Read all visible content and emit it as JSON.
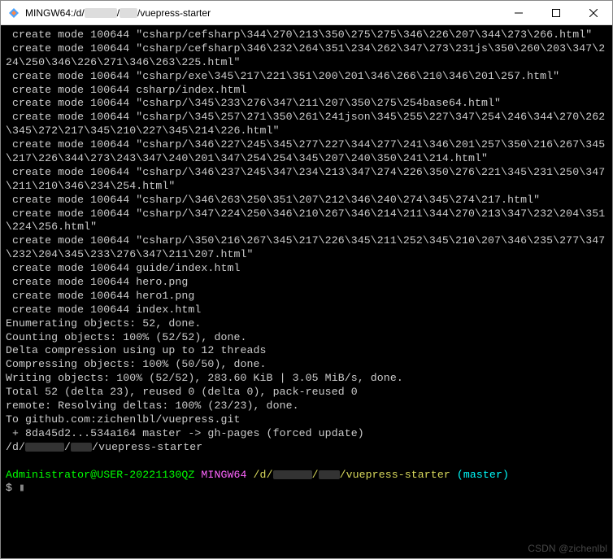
{
  "titlebar": {
    "title_prefix": "MINGW64:/d/",
    "title_suffix": "/vuepress-starter"
  },
  "output_lines": [
    " create mode 100644 \"csharp/cefsharp\\344\\270\\213\\350\\275\\275\\346\\226\\207\\344\\273\\266.html\"",
    " create mode 100644 \"csharp/cefsharp\\346\\232\\264\\351\\234\\262\\347\\273\\231js\\350\\260\\203\\347\\224\\250\\346\\226\\271\\346\\263\\225.html\"",
    " create mode 100644 \"csharp/exe\\345\\217\\221\\351\\200\\201\\346\\266\\210\\346\\201\\257.html\"",
    " create mode 100644 csharp/index.html",
    " create mode 100644 \"csharp/\\345\\233\\276\\347\\211\\207\\350\\275\\254base64.html\"",
    " create mode 100644 \"csharp/\\345\\257\\271\\350\\261\\241json\\345\\255\\227\\347\\254\\246\\344\\270\\262\\345\\272\\217\\345\\210\\227\\345\\214\\226.html\"",
    " create mode 100644 \"csharp/\\346\\227\\245\\345\\277\\227\\344\\277\\241\\346\\201\\257\\350\\216\\267\\345\\217\\226\\344\\273\\243\\347\\240\\201\\347\\254\\254\\345\\207\\240\\350\\241\\214.html\"",
    " create mode 100644 \"csharp/\\346\\237\\245\\347\\234\\213\\347\\274\\226\\350\\276\\221\\345\\231\\250\\347\\211\\210\\346\\234\\254.html\"",
    " create mode 100644 \"csharp/\\346\\263\\250\\351\\207\\212\\346\\240\\274\\345\\274\\217.html\"",
    " create mode 100644 \"csharp/\\347\\224\\250\\346\\210\\267\\346\\214\\211\\344\\270\\213\\347\\232\\204\\351\\224\\256.html\"",
    " create mode 100644 \"csharp/\\350\\216\\267\\345\\217\\226\\345\\211\\252\\345\\210\\207\\346\\235\\277\\347\\232\\204\\345\\233\\276\\347\\211\\207.html\"",
    " create mode 100644 guide/index.html",
    " create mode 100644 hero.png",
    " create mode 100644 hero1.png",
    " create mode 100644 index.html",
    "Enumerating objects: 52, done.",
    "Counting objects: 100% (52/52), done.",
    "Delta compression using up to 12 threads",
    "Compressing objects: 100% (50/50), done.",
    "Writing objects: 100% (52/52), 283.60 KiB | 3.05 MiB/s, done.",
    "Total 52 (delta 23), reused 0 (delta 0), pack-reused 0",
    "remote: Resolving deltas: 100% (23/23), done.",
    "To github.com:zichenlbl/vuepress.git",
    " + 8da45d2...534a164 master -> gh-pages (forced update)"
  ],
  "cwd_line": {
    "prefix": "/d/",
    "suffix": "/vuepress-starter"
  },
  "prompt": {
    "user_host": "Administrator@USER-20221130QZ",
    "env": "MINGW64",
    "path_prefix": "/d/",
    "path_suffix": "/vuepress-starter",
    "branch": "(master)",
    "symbol": "$"
  },
  "watermark": "CSDN @zichenlbl"
}
